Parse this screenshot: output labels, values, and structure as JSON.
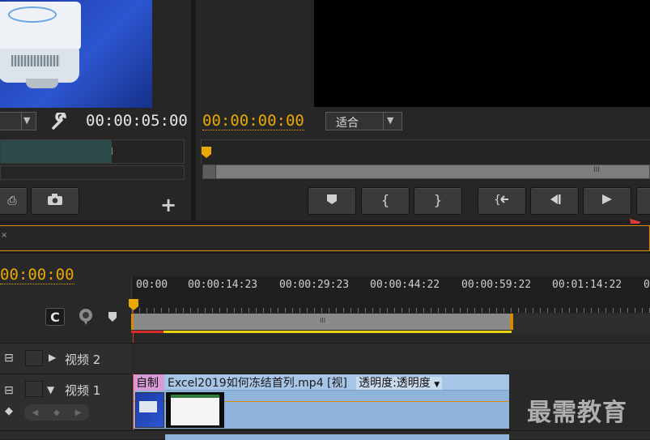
{
  "source_monitor": {
    "timecode": "00:00:05:00",
    "wrench_icon": "wrench-icon",
    "add_label": "+"
  },
  "program_monitor": {
    "timecode": "00:00:00:00",
    "fit_label": "适合",
    "scroll_grip": "III"
  },
  "timeline": {
    "timecode": "00:00:00",
    "ruler_labels": [
      "00:00",
      "00:00:14:23",
      "00:00:29:23",
      "00:00:44:22",
      "00:00:59:22",
      "00:01:14:22",
      "0"
    ],
    "workarea_grip": "III",
    "tracks": {
      "video2": {
        "name": "视频 2"
      },
      "video1": {
        "name": "视频 1"
      }
    },
    "clip": {
      "prefix": "自制",
      "name": "Excel2019如何冻结首列.mp4 [视]",
      "effect": "透明度:透明度"
    }
  },
  "watermark": "最需教育",
  "colors": {
    "accent_yellow": "#e8a800",
    "clip_blue": "#8fb4dc",
    "clip_pink": "#d99ad8",
    "selection_orange": "#d88a00"
  }
}
